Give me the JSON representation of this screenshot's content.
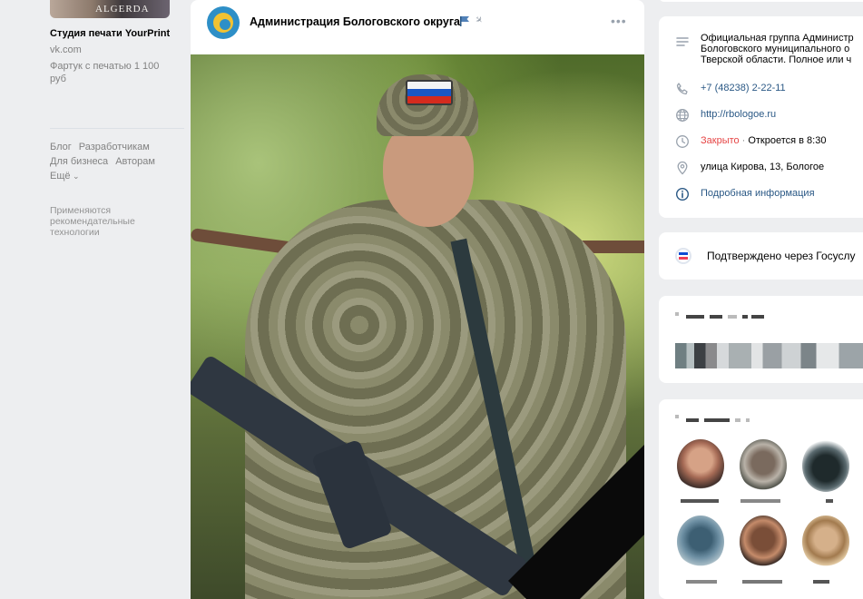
{
  "left": {
    "ad_image_text": "ALGERDA",
    "ad_title": "Студия печати YourPrint",
    "ad_domain": "vk.com",
    "ad_desc": "Фартук с печатью 1 100 руб",
    "links": [
      "Блог",
      "Разработчикам",
      "Для бизнеса",
      "Авторам",
      "Ещё"
    ],
    "note": "Применяются рекомендательные технологии"
  },
  "post": {
    "author": "Администрация Бологовского округа",
    "more": "•••"
  },
  "info": {
    "description": "Официальная группа Администрации Бологовского муниципального округа Тверской области. Полное или ч",
    "description_lines": [
      "Официальная группа Администр",
      "Бологовского муниципального о",
      "Тверской области. Полное или ч"
    ],
    "phone": "+7 (48238) 2-22-11",
    "site": "http://rbologoe.ru",
    "status_closed": "Закрыто",
    "status_sep": "·",
    "status_opens": "Откроется в 8:30",
    "address": "улица Кирова, 13, Бологое",
    "more_info": "Подробная информация"
  },
  "gosuslugi": {
    "text": "Подтверждено через Госуслу"
  },
  "colors": {
    "link": "#2a5885",
    "closed": "#e64646",
    "bg": "#edeef0",
    "card": "#ffffff"
  },
  "icons": [
    "menu-lines-icon",
    "phone-icon",
    "globe-icon",
    "clock-icon",
    "location-pin-icon",
    "info-icon",
    "flag-icon",
    "pin-icon",
    "more-icon",
    "gosuslugi-icon"
  ]
}
